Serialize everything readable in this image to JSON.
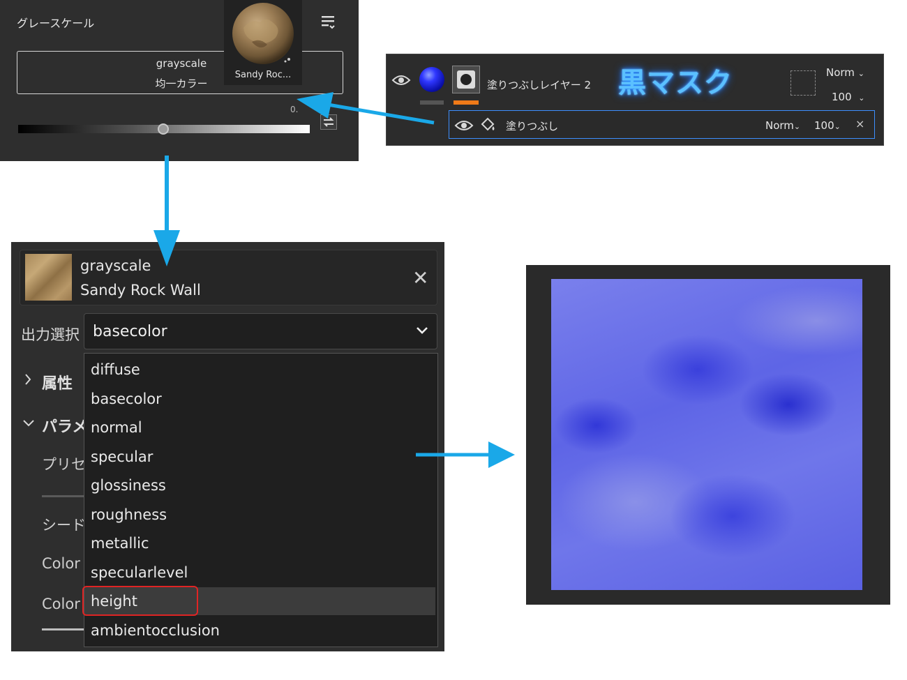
{
  "grayscale_panel": {
    "title": "グレースケール",
    "line1": "grayscale",
    "line2": "均一カラー",
    "thumbnail_label": "Sandy Roc...",
    "value_partial": "0.",
    "slider_value": 0.5
  },
  "layer_panel": {
    "layer_name": "塗りつぶしレイヤー 2",
    "annotation": "黒マスク",
    "blend": "Norm",
    "opacity": "100",
    "sub_layer": {
      "name": "塗りつぶし",
      "blend": "Norm",
      "opacity": "100",
      "close": "×"
    },
    "colors": {
      "selection_border": "#3d8fff",
      "mask_bar": "#f07a18"
    }
  },
  "properties_panel": {
    "card_title": "grayscale",
    "card_subtitle": "Sandy Rock Wall",
    "close": "✕",
    "output_label": "出力選択",
    "output_value": "basecolor",
    "attributes": "属性",
    "parameters": "パラメ-",
    "preset": "プリセッ",
    "seed": "シード",
    "color1": "Color",
    "color2": "Color",
    "options": [
      "diffuse",
      "basecolor",
      "normal",
      "specular",
      "glossiness",
      "roughness",
      "metallic",
      "specularlevel",
      "height",
      "ambientocclusion"
    ],
    "highlighted_option": "height",
    "colors": {
      "highlight_outline": "#e02424"
    }
  },
  "arrow_color": "#1aa8e8"
}
